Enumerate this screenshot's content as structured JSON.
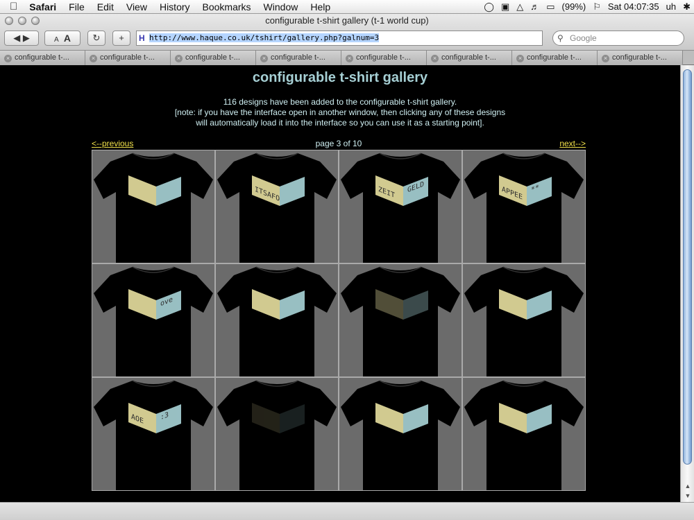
{
  "menubar": {
    "app": "Safari",
    "items": [
      "File",
      "Edit",
      "View",
      "History",
      "Bookmarks",
      "Window",
      "Help"
    ],
    "battery": "(99%)",
    "clock": "Sat 04:07:35",
    "user": "uh"
  },
  "window": {
    "title": "configurable t-shirt gallery (t-1 world cup)"
  },
  "toolbar": {
    "text_smaller": "A",
    "text_larger": "A",
    "reload": "C",
    "add": "+",
    "url": "http://www.haque.co.uk/tshirt/gallery.php?galnum=3",
    "search_placeholder": "Google"
  },
  "tabs": [
    "configurable t-...",
    "configurable t-...",
    "configurable t-...",
    "configurable t-...",
    "configurable t-...",
    "configurable t-...",
    "configurable t-...",
    "configurable t-..."
  ],
  "page": {
    "title": "configurable t-shirt gallery",
    "desc_line1": "116 designs have been added to the configurable t-shirt gallery.",
    "desc_line2": "[note: if you have the interface open in another window, then clicking any of these designs",
    "desc_line3": "will automatically load it into the interface so you can use it as a starting point].",
    "prev": "<--previous",
    "next": "next-->",
    "pagination": "page 3 of 10"
  },
  "designs": [
    {
      "left_text": "",
      "right_text": "",
      "glow": 0.9
    },
    {
      "left_text": "ITSAFO",
      "right_text": "",
      "glow": 0.9
    },
    {
      "left_text": "ZEIT",
      "right_text": "GELD",
      "glow": 0.9
    },
    {
      "left_text": "APPEE",
      "right_text": "**",
      "glow": 0.9
    },
    {
      "left_text": "",
      "right_text": "ove",
      "glow": 0.9
    },
    {
      "left_text": "",
      "right_text": "",
      "glow": 0.9
    },
    {
      "left_text": "",
      "right_text": "",
      "glow": 0.35
    },
    {
      "left_text": "",
      "right_text": "",
      "glow": 0.9
    },
    {
      "left_text": "AOE",
      "right_text": ":3",
      "glow": 0.9
    },
    {
      "left_text": "",
      "right_text": "",
      "glow": 0.15
    },
    {
      "left_text": "",
      "right_text": "",
      "glow": 0.9
    },
    {
      "left_text": "",
      "right_text": "",
      "glow": 0.9
    }
  ],
  "colors": {
    "left_panel": "#e8e0a0",
    "right_panel": "#a9d4d8",
    "shirt": "#000000",
    "cell_bg": "#6b6b6b",
    "title": "#a6cfd4",
    "link": "#f0e04a"
  }
}
